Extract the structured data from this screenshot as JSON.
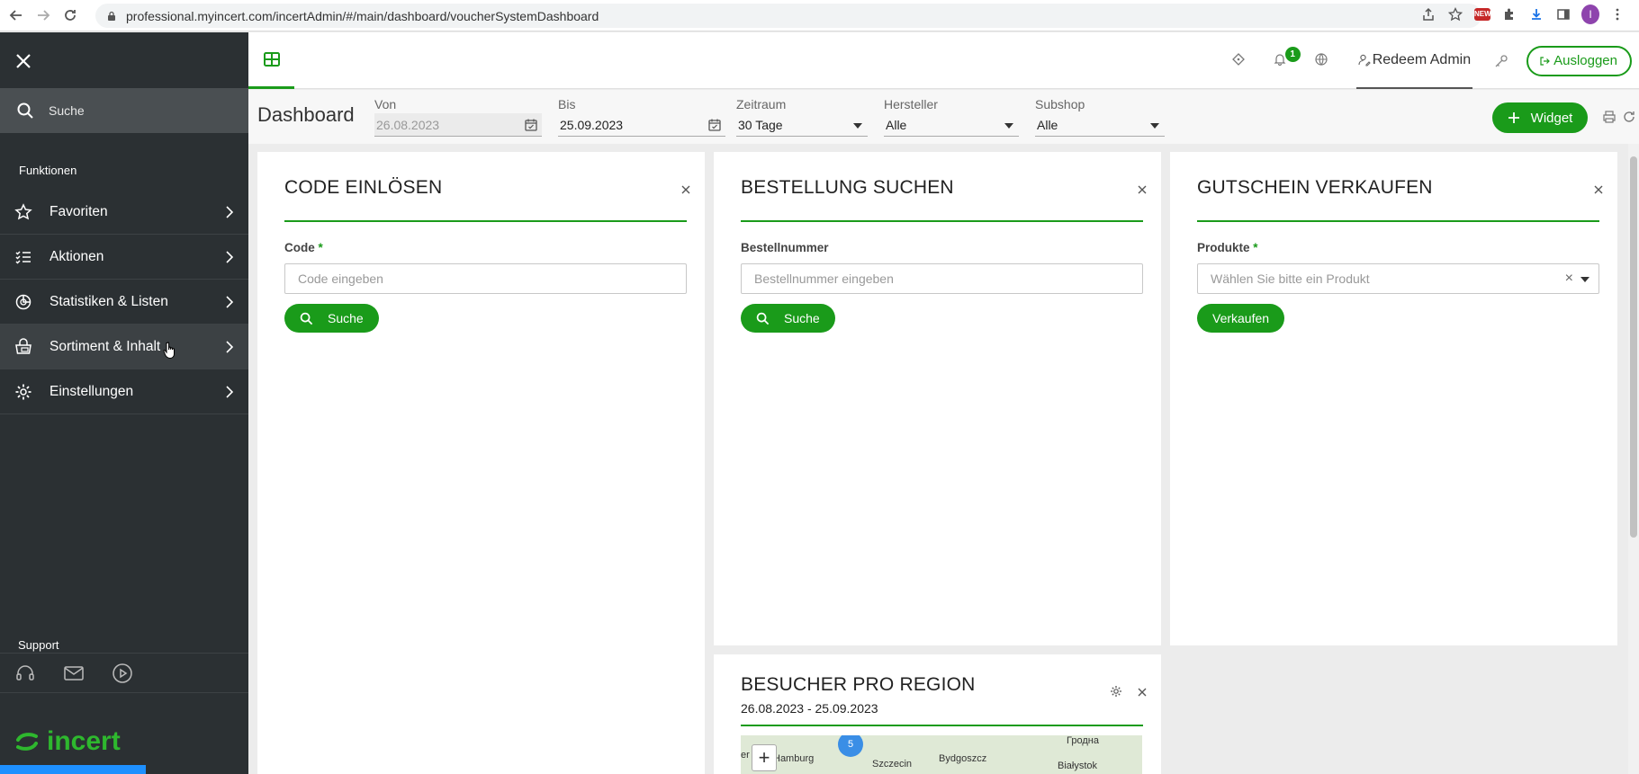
{
  "browser": {
    "url": "professional.myincert.com/incertAdmin/#/main/dashboard/voucherSystemDashboard",
    "profile_initial": "I",
    "ext_label": "NEW"
  },
  "sidebar": {
    "search_label": "Suche",
    "section_title": "Funktionen",
    "items": [
      {
        "label": "Favoriten"
      },
      {
        "label": "Aktionen"
      },
      {
        "label": "Statistiken & Listen"
      },
      {
        "label": "Sortiment & Inhalt"
      },
      {
        "label": "Einstellungen"
      }
    ],
    "support_title": "Support",
    "logo_text": "incert"
  },
  "header": {
    "notification_count": "1",
    "user_name": "Redeem Admin",
    "logout_label": "Ausloggen"
  },
  "filters": {
    "page_title": "Dashboard",
    "von_label": "Von",
    "von_value": "26.08.2023",
    "bis_label": "Bis",
    "bis_value": "25.09.2023",
    "zeitraum_label": "Zeitraum",
    "zeitraum_value": "30 Tage",
    "hersteller_label": "Hersteller",
    "hersteller_value": "Alle",
    "subshop_label": "Subshop",
    "subshop_value": "Alle",
    "widget_label": "Widget"
  },
  "cards": {
    "code": {
      "title": "CODE EINLÖSEN",
      "field_label": "Code",
      "required": "*",
      "placeholder": "Code eingeben",
      "button": "Suche"
    },
    "order": {
      "title": "BESTELLUNG SUCHEN",
      "field_label": "Bestellnummer",
      "placeholder": "Bestellnummer eingeben",
      "button": "Suche"
    },
    "voucher": {
      "title": "GUTSCHEIN VERKAUFEN",
      "field_label": "Produkte",
      "required": "*",
      "placeholder": "Wählen Sie bitte ein Produkt",
      "clear": "×",
      "button": "Verkaufen"
    },
    "visitors": {
      "title": "BESUCHER PRO REGION",
      "date_range": "26.08.2023 - 25.09.2023",
      "map": {
        "cluster_count": "5",
        "zoom_in": "+",
        "cities": [
          "Hamburg",
          "Szczecin",
          "Bydgoszcz",
          "Гродна",
          "Białystok",
          "er"
        ]
      }
    }
  }
}
